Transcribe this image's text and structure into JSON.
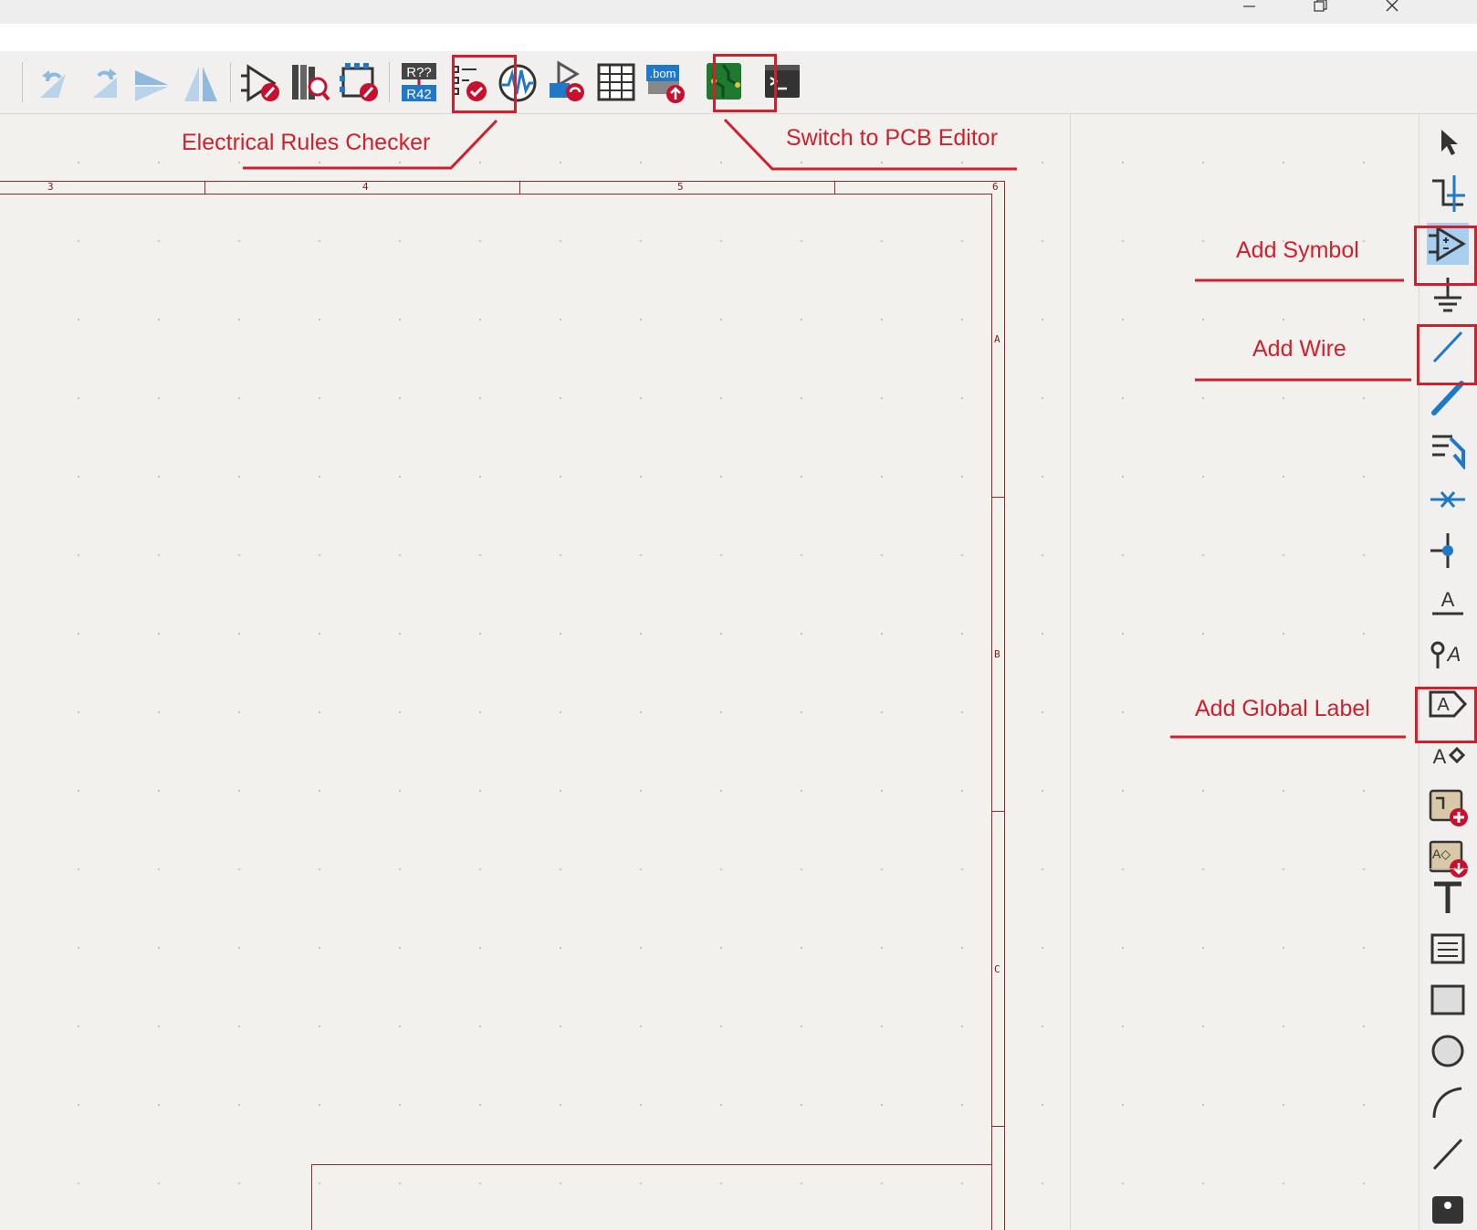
{
  "window": {
    "controls": [
      {
        "name": "minimize",
        "glyph": "—"
      },
      {
        "name": "restore",
        "glyph": "❐"
      },
      {
        "name": "close",
        "glyph": "✕"
      }
    ]
  },
  "toolbar": {
    "annotate_badge": {
      "top": "R??",
      "bottom": "R42"
    },
    "bom_badge": ".bom",
    "icons": [
      "back-arrow-icon",
      "undo-icon",
      "redo-icon",
      "mirror-horizontal-icon",
      "mirror-vertical-icon",
      "symbol-editor-icon",
      "symbol-library-browser-icon",
      "footprint-editor-icon",
      "annotate-icon",
      "erc-icon",
      "simulator-icon",
      "assign-footprints-icon",
      "symbol-fields-table-icon",
      "generate-bom-icon",
      "pcb-editor-icon",
      "scripting-console-icon"
    ]
  },
  "ruler": {
    "top_labels": [
      "3",
      "4",
      "5",
      "6"
    ],
    "side_labels": [
      "A",
      "B",
      "C"
    ]
  },
  "right_toolbar": {
    "icons": [
      "select-arrow-icon",
      "highlight-net-icon",
      "add-symbol-icon",
      "add-power-icon",
      "add-wire-icon",
      "add-bus-icon",
      "bus-entry-icon",
      "no-connect-icon",
      "junction-icon",
      "net-label-icon",
      "net-class-directive-icon",
      "global-label-icon",
      "hierarchical-label-icon",
      "add-sheet-icon",
      "import-sheet-pin-icon",
      "text-icon",
      "text-box-icon",
      "rectangle-icon",
      "circle-icon",
      "arc-icon",
      "line-icon",
      "image-icon"
    ]
  },
  "annotations": {
    "erc": "Electrical Rules Checker",
    "pcb": "Switch to PCB Editor",
    "symbol": "Add Symbol",
    "wire": "Add Wire",
    "global_label": "Add Global Label"
  },
  "colors": {
    "annotation": "#d0202e",
    "frame": "#8a2a2a",
    "canvas": "#f3f1ed",
    "icon_blue": "#1f78c8",
    "icon_red": "#c8102e"
  }
}
